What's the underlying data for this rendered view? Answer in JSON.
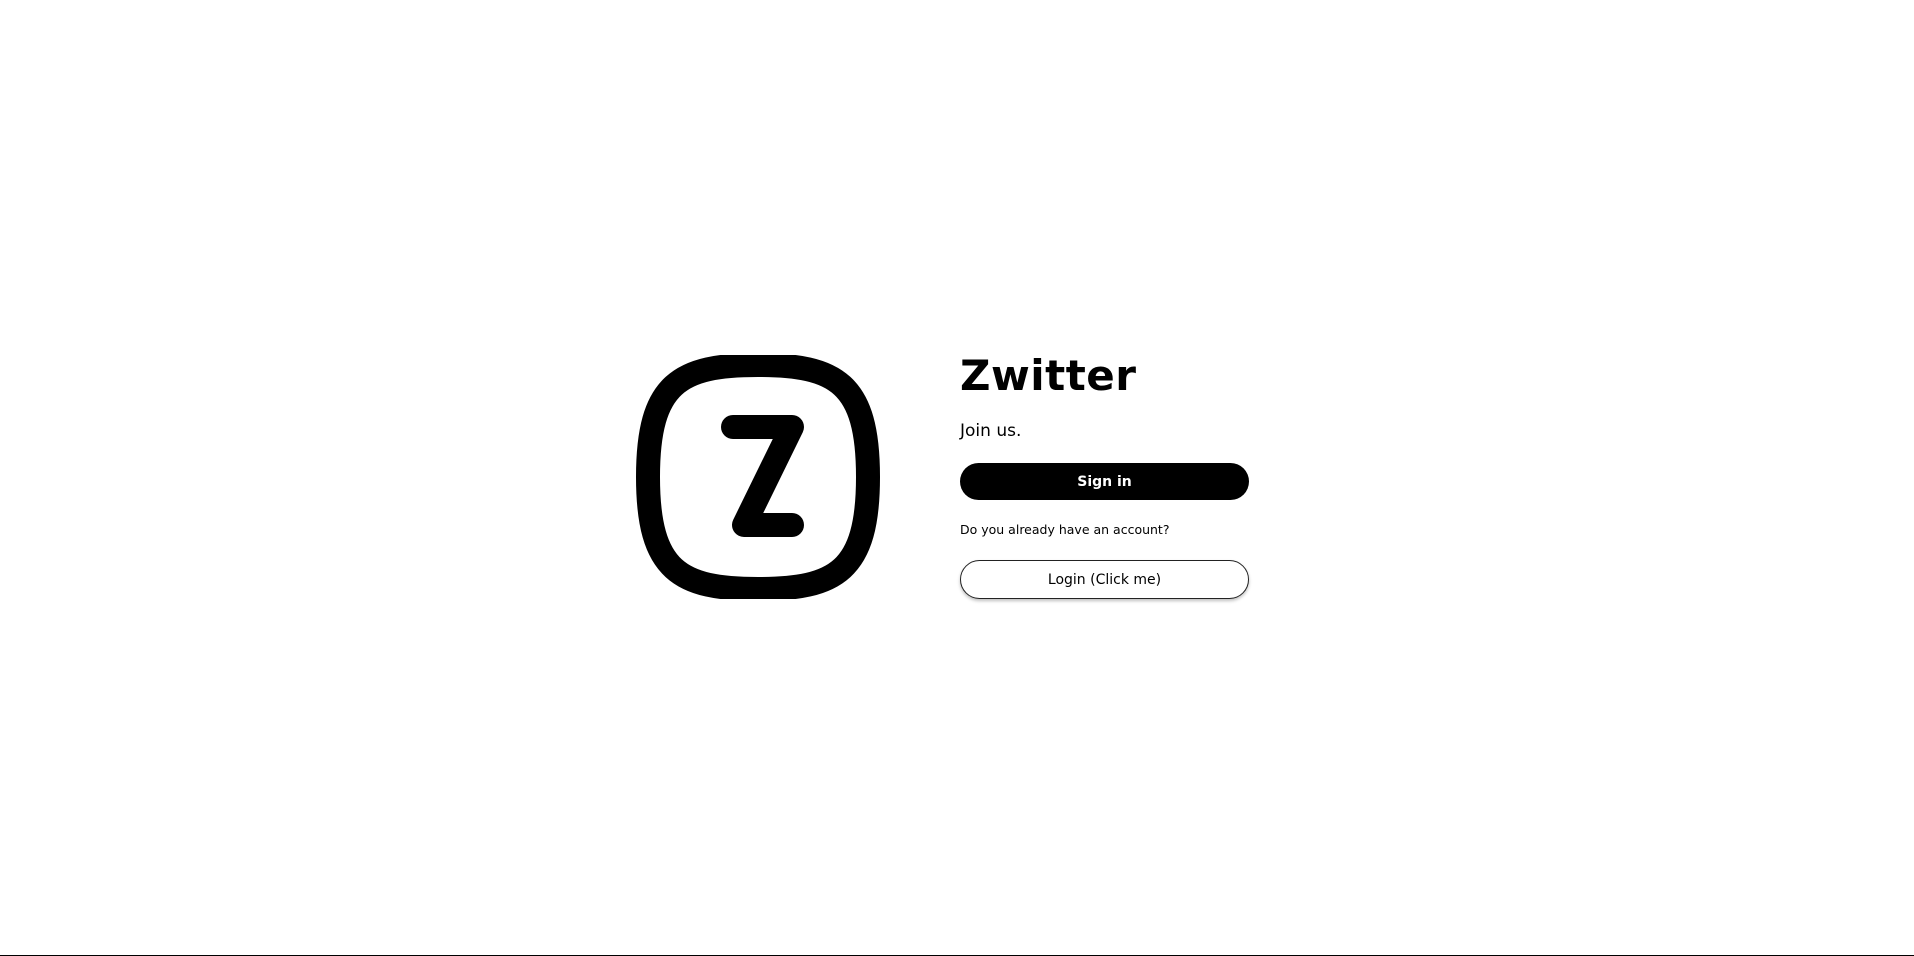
{
  "app": {
    "logo_icon": "zwitter-z-logo-icon",
    "title": "Zwitter",
    "tagline": "Join us."
  },
  "actions": {
    "signin_label": "Sign in",
    "account_question": "Do you already have an account?",
    "login_label": "Login (Click me)"
  },
  "colors": {
    "primary": "#000000",
    "background": "#ffffff"
  }
}
